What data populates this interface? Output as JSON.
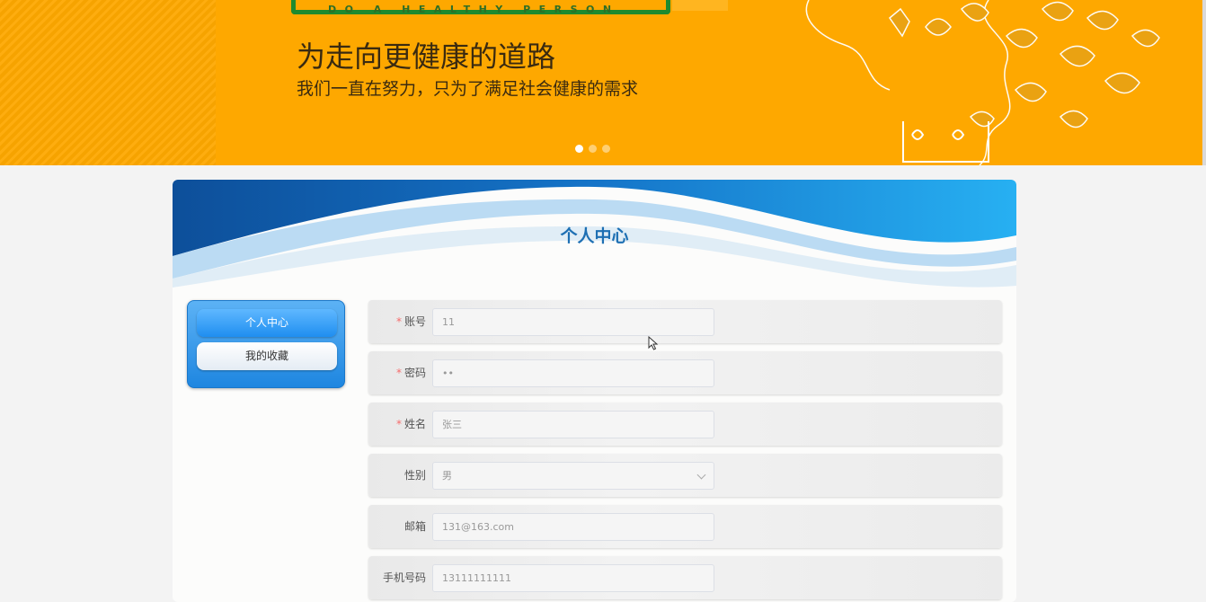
{
  "banner": {
    "logo_subtitle": "DO A HEALTHY PERSON",
    "title": "为走向更健康的道路",
    "subtitle": "我们一直在努力，只为了满足社会健康的需求",
    "carousel_dots": 3,
    "active_dot": 0,
    "background_color": "#fea800"
  },
  "page": {
    "title": "个人中心"
  },
  "sidebar": {
    "items": [
      {
        "label": "个人中心",
        "active": true
      },
      {
        "label": "我的收藏",
        "active": false
      }
    ]
  },
  "form": {
    "fields": [
      {
        "label": "账号",
        "required": true,
        "value": "11"
      },
      {
        "label": "密码",
        "required": true,
        "value": "••"
      },
      {
        "label": "姓名",
        "required": true,
        "value": "张三"
      },
      {
        "label": "性别",
        "required": false,
        "value": "男"
      },
      {
        "label": "邮箱",
        "required": false,
        "value": "131@163.com"
      },
      {
        "label": "手机号码",
        "required": false,
        "value": "13111111111"
      }
    ]
  },
  "colors": {
    "accent_blue": "#1f8ef0",
    "title_blue": "#1d6fb3",
    "required_red": "#f56c6c"
  }
}
